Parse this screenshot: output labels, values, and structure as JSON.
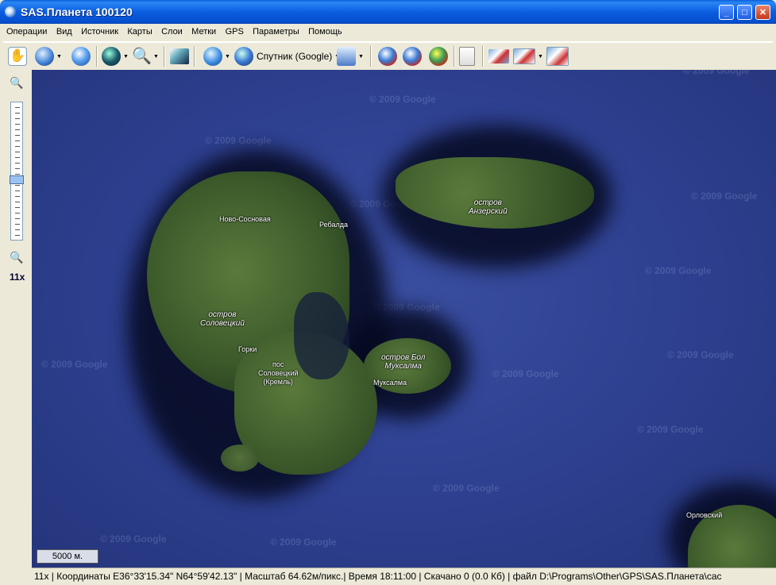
{
  "window": {
    "title": "SAS.Планета 100120"
  },
  "menu": [
    "Операции",
    "Вид",
    "Источник",
    "Карты",
    "Слои",
    "Метки",
    "GPS",
    "Параметры",
    "Помощь"
  ],
  "toolbar": {
    "source_label": "Спутник (Google)"
  },
  "zoom": {
    "level": "11x"
  },
  "map": {
    "labels": {
      "novo_sosnovaya": "Ново-Сосновая",
      "rebalda": "Ребалда",
      "solovetsky_island": "остров\nСоловецкий",
      "gorki": "Горки",
      "kreml": "пос\nСоловецкий\n(Кремль)",
      "anzersky": "остров\nАнзерский",
      "bolshaya_muksalma": "остров Бол\nМуксалма",
      "muksalma": "Муксалма",
      "orlovsky": "Орловский"
    },
    "watermark": "© 2009 Google",
    "scale": "5000 м."
  },
  "status": {
    "text": "11x | Координаты E36°33'15.34\" N64°59'42.13\" | Масштаб 64.62м/пикс.| Время 18:11:00 | Скачано 0 (0.0 Кб) | файл D:\\Programs\\Other\\GPS\\SAS.Планета\\cac"
  }
}
